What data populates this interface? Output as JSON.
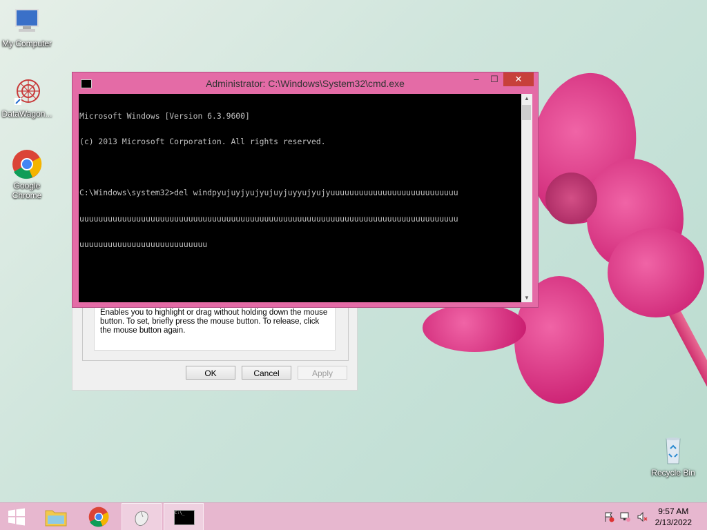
{
  "desktop": {
    "icons": [
      {
        "label": "My Computer"
      },
      {
        "label": "DataWagon..."
      },
      {
        "label": "Google Chrome"
      },
      {
        "label": "Recycle Bin"
      }
    ]
  },
  "dialog": {
    "description": "Enables you to highlight or drag without holding down the mouse button. To set, briefly press the mouse button. To release, click the mouse button again.",
    "ok_label": "OK",
    "cancel_label": "Cancel",
    "apply_label": "Apply"
  },
  "cmd": {
    "title": "Administrator: C:\\Windows\\System32\\cmd.exe",
    "lines": [
      "Microsoft Windows [Version 6.3.9600]",
      "(c) 2013 Microsoft Corporation. All rights reserved.",
      "",
      "C:\\Windows\\system32>del windpyujuyjyujyujuyjuyyujyujyuuuuuuuuuuuuuuuuuuuuuuuuuuu",
      "uuuuuuuuuuuuuuuuuuuuuuuuuuuuuuuuuuuuuuuuuuuuuuuuuuuuuuuuuuuuuuuuuuuuuuuuuuuuuuuu",
      "uuuuuuuuuuuuuuuuuuuuuuuuuuu"
    ],
    "minimize_glyph": "–",
    "maximize_glyph": "☐",
    "close_glyph": "✕"
  },
  "taskbar": {
    "time": "9:57 AM",
    "date": "2/13/2022"
  },
  "colors": {
    "cmd_frame": "#e46ba6",
    "taskbar": "#e7b7cf",
    "close_button": "#c7403a"
  },
  "icons": [
    "computer-icon",
    "datawagon-icon",
    "chrome-icon",
    "recycle-bin-icon",
    "start-icon",
    "file-explorer-icon",
    "mouse-properties-icon",
    "cmd-icon",
    "flag-icon",
    "network-icon",
    "volume-muted-icon"
  ]
}
